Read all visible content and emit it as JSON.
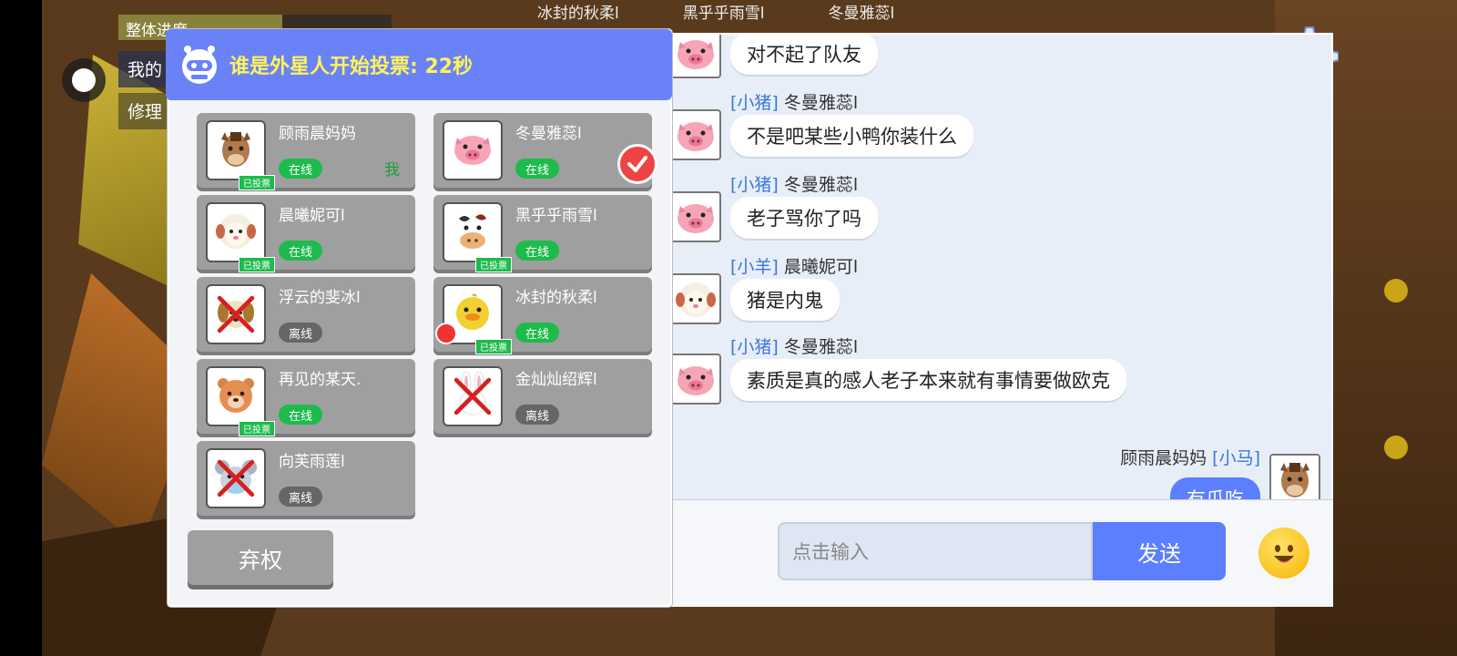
{
  "hud": {
    "progress_label": "整体进度",
    "progress_fraction": 0.6,
    "side_labels": [
      "我的",
      "修理"
    ],
    "top_names": [
      "冰封的秋柔l",
      "黑乎乎雨雪l",
      "冬曼雅蕊l"
    ]
  },
  "vote": {
    "title": "谁是外星人开始投票: 22秒",
    "voted_label": "已投票",
    "me_label": "我",
    "abstain_label": "弃权",
    "players": [
      {
        "name": "顾雨晨妈妈",
        "status": "在线",
        "voted": true,
        "is_me": true,
        "checked": false,
        "avatar": "horse",
        "eliminated": false
      },
      {
        "name": "冬曼雅蕊l",
        "status": "在线",
        "voted": false,
        "is_me": false,
        "checked": true,
        "avatar": "pig",
        "eliminated": false
      },
      {
        "name": "晨曦妮可l",
        "status": "在线",
        "voted": true,
        "is_me": false,
        "checked": false,
        "avatar": "sheep",
        "eliminated": false
      },
      {
        "name": "黑乎乎雨雪l",
        "status": "在线",
        "voted": true,
        "is_me": false,
        "checked": false,
        "avatar": "cow",
        "eliminated": false
      },
      {
        "name": "浮云的斐冰l",
        "status": "离线",
        "voted": false,
        "is_me": false,
        "checked": false,
        "avatar": "dog",
        "eliminated": true
      },
      {
        "name": "冰封的秋柔l",
        "status": "在线",
        "voted": true,
        "is_me": false,
        "checked": false,
        "avatar": "chick",
        "eliminated": false
      },
      {
        "name": "再见的某天.",
        "status": "在线",
        "voted": true,
        "is_me": false,
        "checked": false,
        "avatar": "bear",
        "eliminated": false
      },
      {
        "name": "金灿灿绍辉l",
        "status": "离线",
        "voted": false,
        "is_me": false,
        "checked": false,
        "avatar": "rabbit",
        "eliminated": true
      },
      {
        "name": "向芙雨莲l",
        "status": "离线",
        "voted": false,
        "is_me": false,
        "checked": false,
        "avatar": "mouse",
        "eliminated": true
      }
    ]
  },
  "chat": {
    "messages": [
      {
        "tag": "[小猪]",
        "user": "冬曼雅蕊l",
        "text": "对不起了队友",
        "avatar": "pig"
      },
      {
        "tag": "[小猪]",
        "user": "冬曼雅蕊l",
        "text": "不是吧某些小鸭你装什么",
        "avatar": "pig"
      },
      {
        "tag": "[小猪]",
        "user": "冬曼雅蕊l",
        "text": "老子骂你了吗",
        "avatar": "pig"
      },
      {
        "tag": "[小羊]",
        "user": "晨曦妮可l",
        "text": "猪是内鬼",
        "avatar": "sheep"
      },
      {
        "tag": "[小猪]",
        "user": "冬曼雅蕊l",
        "text": "素质是真的感人老子本来就有事情要做欧克",
        "avatar": "pig"
      }
    ],
    "self_message": {
      "user": "顾雨晨妈妈",
      "tag": "[小马]",
      "text": "有瓜吃",
      "avatar": "horse"
    },
    "input_placeholder": "点击输入",
    "send_label": "发送"
  },
  "colors": {
    "accent": "#6a82f7",
    "title_yellow": "#fff35a",
    "online": "#1dbb4b",
    "offline": "#666666",
    "chat_tag": "#3b78d8"
  }
}
